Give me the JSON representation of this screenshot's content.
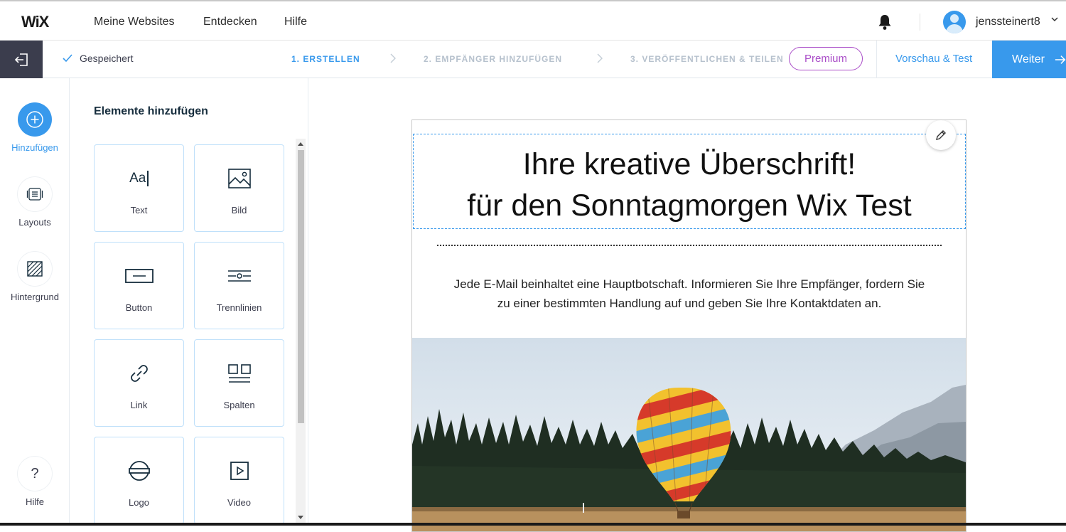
{
  "topnav": {
    "logo": "WiX",
    "links": [
      "Meine Websites",
      "Entdecken",
      "Hilfe"
    ],
    "username": "jenssteinert8"
  },
  "stepbar": {
    "saved_label": "Gespeichert",
    "steps": [
      "1. ERSTELLEN",
      "2. EMPFÄNGER HINZUFÜGEN",
      "3. VERÖFFENTLICHEN & TEILEN"
    ],
    "active_step": 0,
    "premium_label": "Premium",
    "preview_label": "Vorschau & Test",
    "next_label": "Weiter"
  },
  "rail": {
    "items": [
      {
        "label": "Hinzufügen",
        "icon": "plus-icon",
        "active": true
      },
      {
        "label": "Layouts",
        "icon": "layouts-icon",
        "active": false
      },
      {
        "label": "Hintergrund",
        "icon": "background-icon",
        "active": false
      }
    ],
    "help_label": "Hilfe"
  },
  "panel": {
    "title": "Elemente hinzufügen",
    "tiles": [
      {
        "label": "Text",
        "icon": "text-icon"
      },
      {
        "label": "Bild",
        "icon": "image-icon"
      },
      {
        "label": "Button",
        "icon": "button-icon"
      },
      {
        "label": "Trennlinien",
        "icon": "divider-icon"
      },
      {
        "label": "Link",
        "icon": "link-icon"
      },
      {
        "label": "Spalten",
        "icon": "columns-icon"
      },
      {
        "label": "Logo",
        "icon": "logo-icon"
      },
      {
        "label": "Video",
        "icon": "video-icon"
      }
    ],
    "text_icon_glyph": "Aa"
  },
  "email": {
    "headline_line1": "Ihre kreative Überschrift!",
    "headline_line2": "für den Sonntagmorgen Wix Test",
    "body_line1": "Jede E-Mail beinhaltet eine Hauptbotschaft. Informieren Sie Ihre Empfänger, fordern Sie",
    "body_line2": "zu einer bestimmten Handlung auf und geben Sie Ihre Kontaktdaten an."
  },
  "colors": {
    "accent": "#3899ec",
    "premium": "#aa4dc8",
    "exit_bg": "#3b3d4d"
  }
}
